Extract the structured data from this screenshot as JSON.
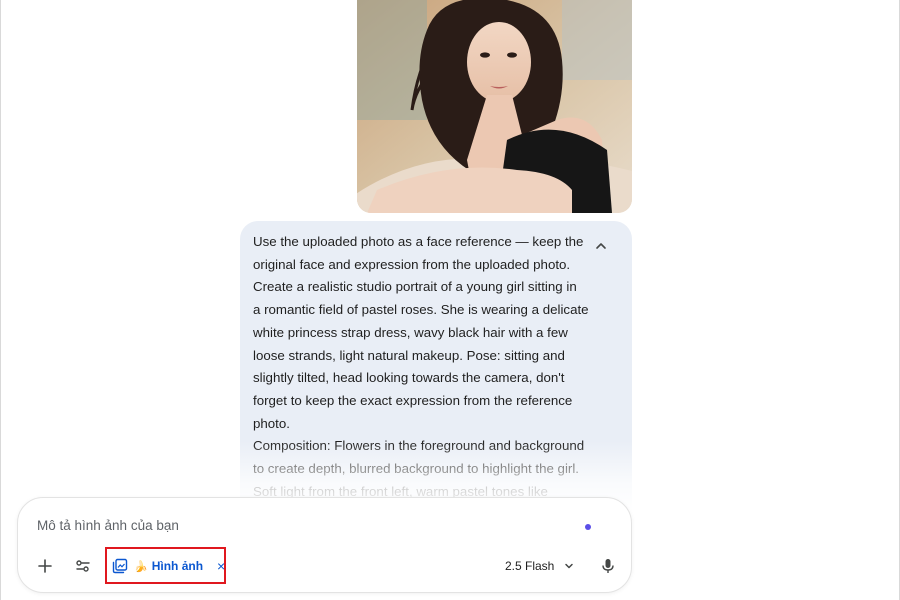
{
  "prompt_bubble": {
    "text": "Use the uploaded photo as a face reference — keep the\noriginal face and expression from the uploaded photo.\nCreate a realistic studio portrait of a young girl sitting in\na romantic field of pastel roses. She is wearing a delicate\nwhite princess strap dress, wavy black hair with a few\nloose strands, light natural makeup. Pose: sitting and\nslightly tilted, head looking towards the camera, don't\nforget to keep the exact expression from the reference\nphoto.\nComposition: Flowers in the foreground and background\nto create depth, blurred background to highlight the girl.\nSoft light from the front left, warm pastel tones like",
    "collapse_icon": "chevron-up-icon"
  },
  "composer": {
    "placeholder": "Mô tả hình ảnh của bạn",
    "tool_chip_label": "Hình ảnh",
    "tool_chip_emoji": "🍌",
    "tool_chip_close": "×",
    "model_label": "2.5 Flash",
    "icons": {
      "add": "plus-icon",
      "tools": "tune-icon",
      "chip": "image-stack-icon",
      "model_dropdown": "chevron-down-icon",
      "mic": "microphone-icon"
    }
  },
  "colors": {
    "bubble_bg": "#e9eef6",
    "accent_blue": "#0b57d0",
    "highlight_red": "#e0181f",
    "dot_purple": "#5b4fe8"
  }
}
